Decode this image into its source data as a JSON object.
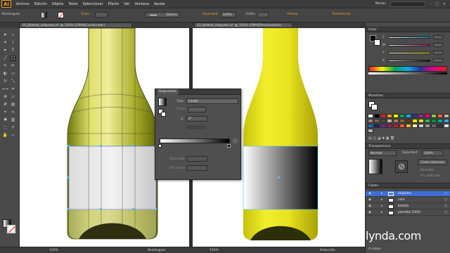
{
  "menubar": {
    "logo": "Ai",
    "items": [
      "Archivo",
      "Edición",
      "Objeto",
      "Texto",
      "Seleccionar",
      "Efecto",
      "Ver",
      "Ventana",
      "Ayuda"
    ],
    "user": "Marías",
    "search_placeholder": ""
  },
  "controlbar": {
    "selection_label": "Rectángulo",
    "trazo_label": "Trazo:",
    "stroke_style": "Básico",
    "opacity_label": "Opacidad:",
    "opacity_value": "100%",
    "style_label": "Estilo:",
    "align_label": "Alinear",
    "transform_label": "Transformar"
  },
  "tabs": [
    {
      "label": "03_Botella_etiqueta.ai* @ 150% (CMYK/Contornear)"
    },
    {
      "label": "03_Botella_etiqueta.ai* @ 150% (CMYK/Previsualizar)"
    }
  ],
  "gradient_panel": {
    "title": "Degradado",
    "tipo_label": "Tipo:",
    "tipo_value": "Lineal",
    "trazo_label": "Trazo:",
    "angle_value": "0°",
    "opacidad_label": "Opacidad:",
    "ubicacion_label": "Ubicación:"
  },
  "color_panel": {
    "title": "Color",
    "channels": [
      "C",
      "M",
      "Y",
      "K"
    ]
  },
  "swatches_panel": {
    "title": "Muestras",
    "colors": [
      "#ffffff",
      "#000000",
      "#ed1c24",
      "#f7941d",
      "#fff200",
      "#00a651",
      "#00aeef",
      "#2e3192",
      "#92278f",
      "#ec008c",
      "#8dc63f",
      "#f26522",
      "#c7b299",
      "#998675",
      "#736357",
      "#534741",
      "#c2b59b",
      "#a67c52",
      "#8c6239",
      "#603913",
      "#ffe600",
      "#d7df23",
      "#39b54a",
      "#009444",
      "#00a99d",
      "#27aae1",
      "#1c75bc",
      "#262262",
      "#662d91",
      "#9e1f63",
      "#be1e2d",
      "#f15a29",
      "#fbb040",
      "#fff799",
      "#cccccc",
      "#999999",
      "#666666",
      "#333333",
      "#e6e6e6",
      "#b3b3b3"
    ]
  },
  "transparency_panel": {
    "title": "Transparencia",
    "mode": "Normal",
    "opacity_label": "Opacidad:",
    "opacity_value": "100%",
    "create_mask": "Crear máscara",
    "clip_label": "Recortar",
    "invert_label": "Inv. máscara"
  },
  "layers_panel": {
    "title": "Capas",
    "layers": [
      {
        "name": "etiqueta",
        "color": "#4f7bff"
      },
      {
        "name": "cola",
        "color": "#ffffff"
      },
      {
        "name": "botella",
        "color": "#ffffff"
      },
      {
        "name": "plantilla 100%",
        "color": "#ffffff"
      }
    ],
    "footer": "4 capas"
  },
  "status": {
    "zoom_left": "150%",
    "tool_left": "Rectángulo",
    "zoom_right": "150%",
    "tool_right": "Selección"
  },
  "watermark": "lynda.com"
}
